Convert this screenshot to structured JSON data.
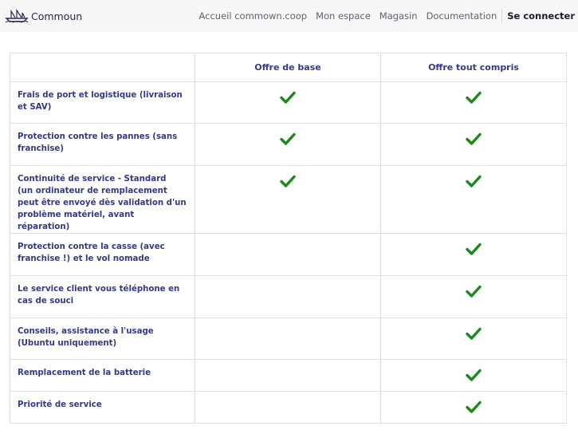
{
  "header": {
    "logo_text": "Commoun",
    "nav": [
      "Accueil commown.coop",
      "Mon espace",
      "Magasin",
      "Documentation"
    ],
    "login_label": "Se connecter"
  },
  "table": {
    "columns": [
      "",
      "Offre de base",
      "Offre tout compris"
    ],
    "rows": [
      {
        "feature": "Frais de port et logistique (livraison et SAV)",
        "base": true,
        "full": true
      },
      {
        "feature": "Protection contre les pannes (sans franchise)",
        "base": true,
        "full": true
      },
      {
        "feature": "Continuité de service - Standard",
        "subtext": "(un ordinateur de remplacement peut être envoyé dès validation d'un problème matériel, avant réparation)",
        "base": true,
        "full": true
      },
      {
        "feature": "Protection contre la casse (avec franchise !) et le vol nomade",
        "base": false,
        "full": true
      },
      {
        "feature": "Le service client vous téléphone en cas de souci",
        "base": false,
        "full": true
      },
      {
        "feature": "Conseils, assistance à l'usage (Ubuntu uniquement)",
        "base": false,
        "full": true
      },
      {
        "feature": "Remplacement de la batterie",
        "base": false,
        "full": true
      },
      {
        "feature": "Priorité de service",
        "base": false,
        "full": true
      }
    ]
  },
  "colors": {
    "accent": "#333a87",
    "check": "#1a8a1a",
    "topbar": "#f7f7f7"
  },
  "icons": {
    "included": "checkmark-icon",
    "logo": "boat-logo-icon"
  }
}
